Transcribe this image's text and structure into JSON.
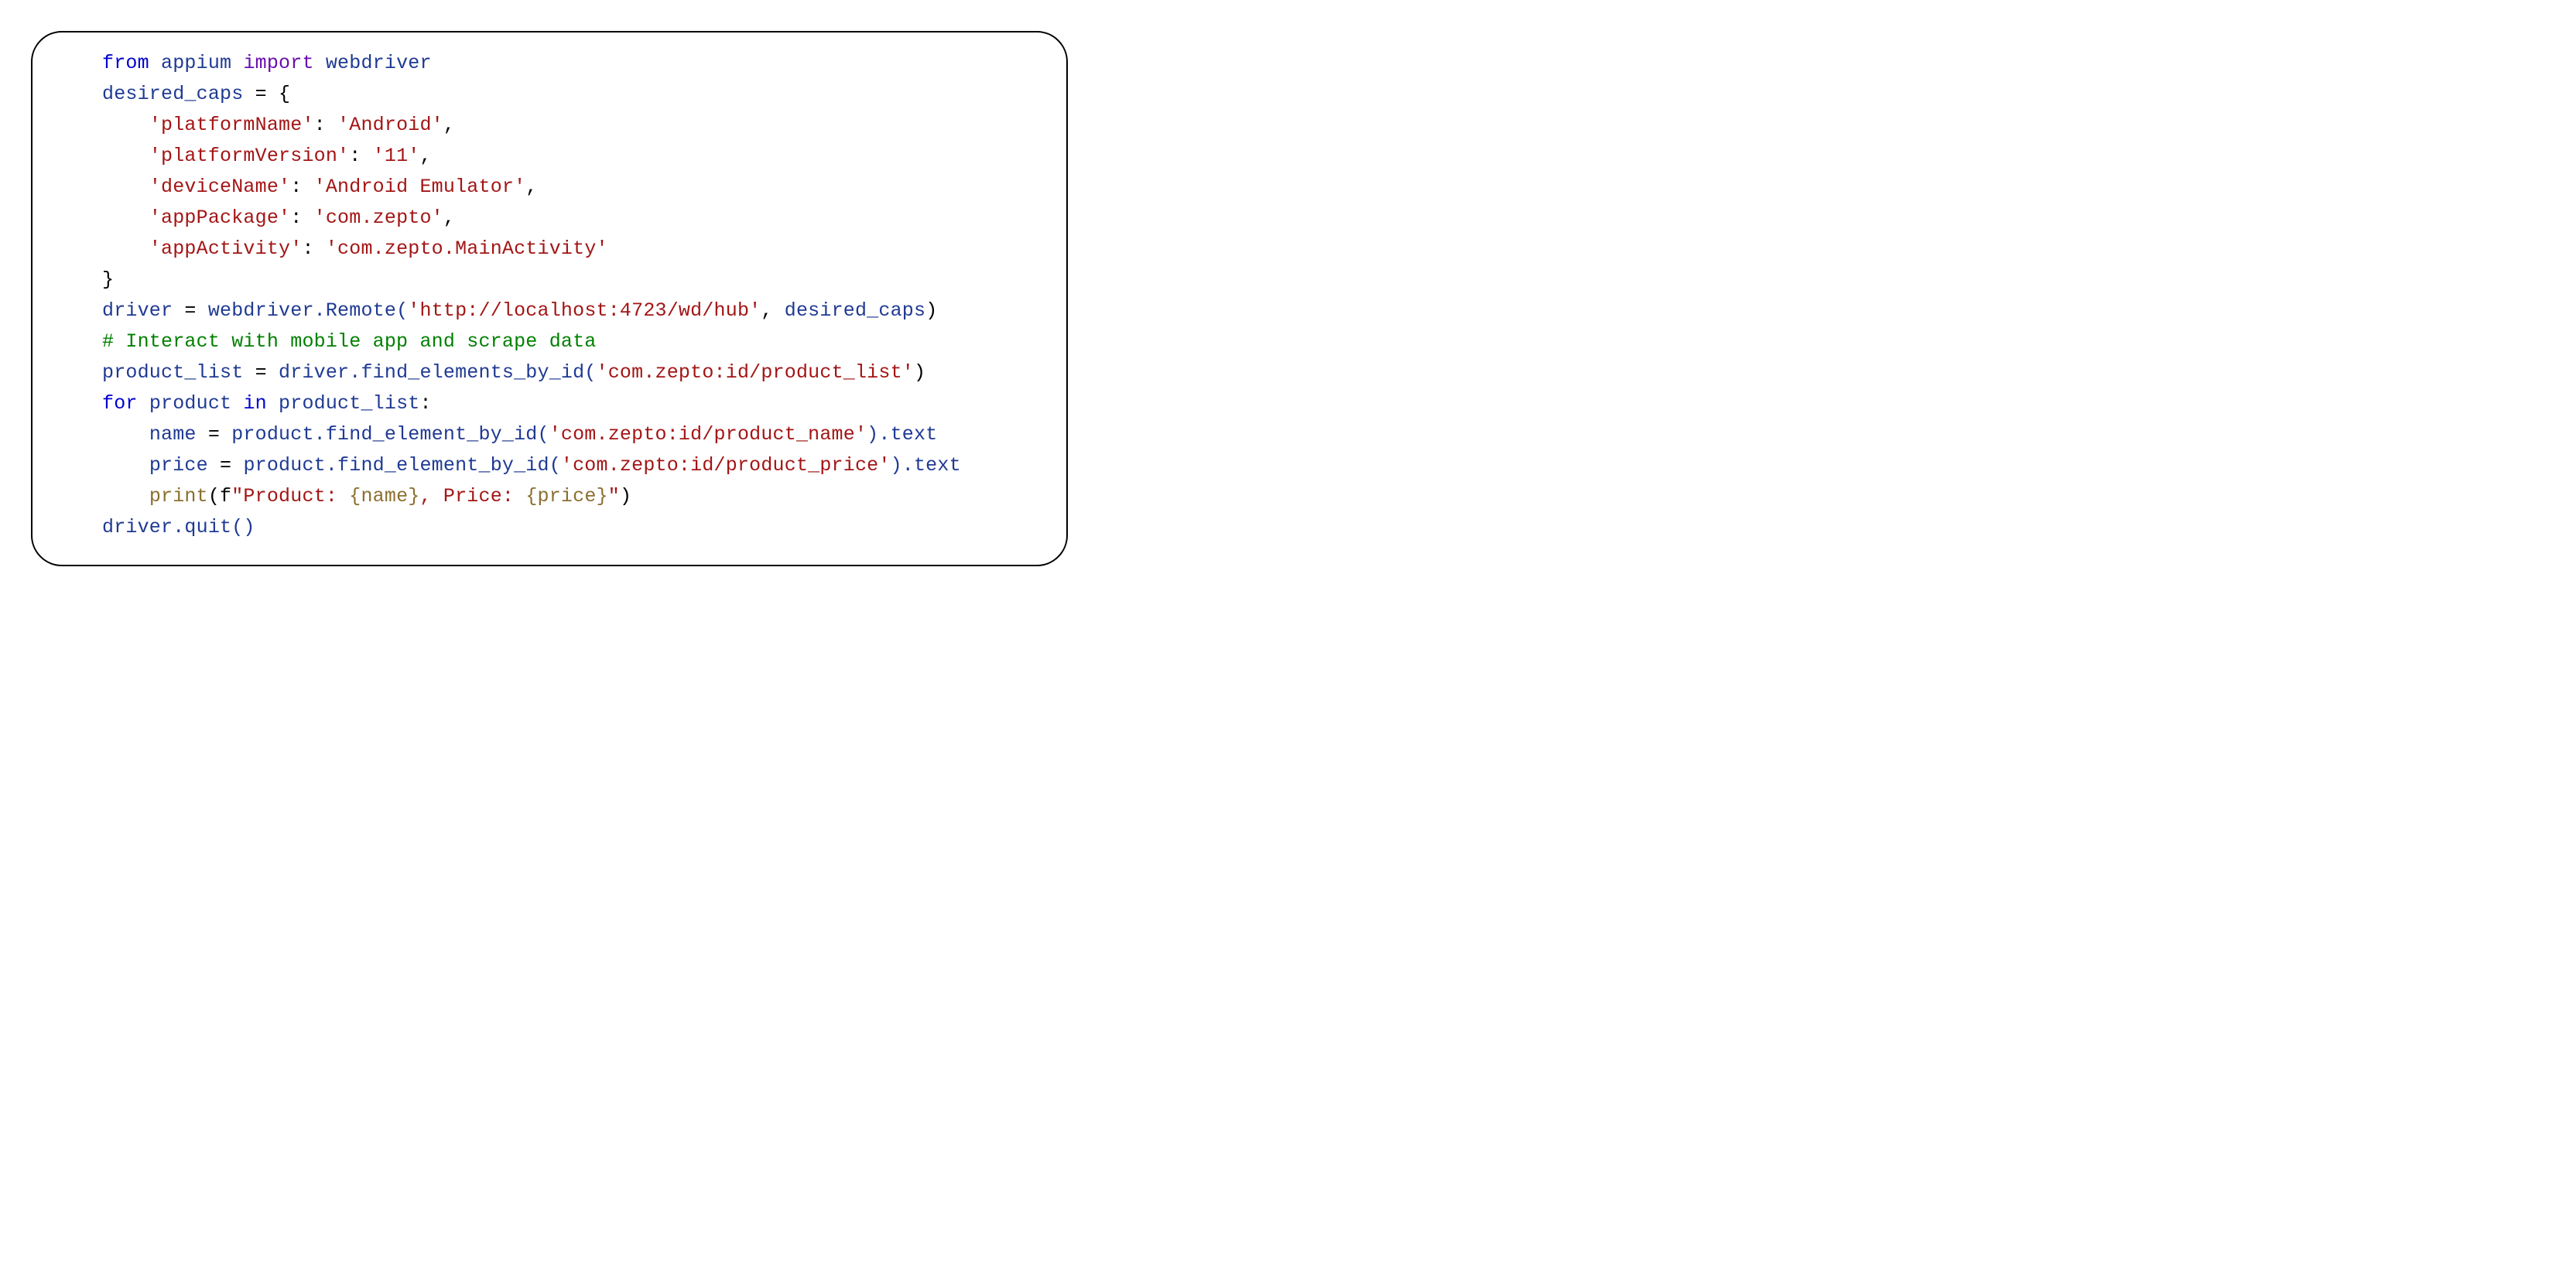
{
  "code": {
    "l1": {
      "kw_from": "from",
      "mod_appium": "appium",
      "kw_import": "import",
      "mod_webdriver": "webdriver"
    },
    "l2": {
      "var_desired_caps": "desired_caps",
      "eq": " = {"
    },
    "l3": {
      "indent": "    ",
      "key": "'platformName'",
      "colon": ": ",
      "val": "'Android'",
      "comma": ","
    },
    "l4": {
      "indent": "    ",
      "key": "'platformVersion'",
      "colon": ": ",
      "val": "'11'",
      "comma": ","
    },
    "l5": {
      "indent": "    ",
      "key": "'deviceName'",
      "colon": ": ",
      "val": "'Android Emulator'",
      "comma": ","
    },
    "l6": {
      "indent": "    ",
      "key": "'appPackage'",
      "colon": ": ",
      "val": "'com.zepto'",
      "comma": ","
    },
    "l7": {
      "indent": "    ",
      "key": "'appActivity'",
      "colon": ": ",
      "val": "'com.zepto.MainActivity'"
    },
    "l8": {
      "close": "}"
    },
    "l9": {
      "var_driver": "driver",
      "eq": " = ",
      "call1": "webdriver.Remote(",
      "url": "'http://localhost:4723/wd/hub'",
      "comma": ", ",
      "arg": "desired_caps",
      "close": ")"
    },
    "l10": {
      "comment": "# Interact with mobile app and scrape data"
    },
    "l11": {
      "var_pl": "product_list",
      "eq": " = ",
      "call": "driver.find_elements_by_id(",
      "arg": "'com.zepto:id/product_list'",
      "close": ")"
    },
    "l12": {
      "kw_for": "for",
      "sp1": " ",
      "var_product": "product",
      "sp2": " ",
      "kw_in": "in",
      "sp3": " ",
      "var_pl": "product_list",
      "colon": ":"
    },
    "l13": {
      "indent": "    ",
      "var_name": "name",
      "eq": " = ",
      "call": "product.find_element_by_id(",
      "arg": "'com.zepto:id/product_name'",
      "close": ").text"
    },
    "l14": {
      "indent": "    ",
      "var_price": "price",
      "eq": " = ",
      "call": "product.find_element_by_id(",
      "arg": "'com.zepto:id/product_price'",
      "close": ").text"
    },
    "l15": {
      "indent": "    ",
      "fn_print": "print",
      "open": "(f",
      "s1": "\"Product: ",
      "br1": "{name}",
      "s2": ", Price: ",
      "br2": "{price}",
      "s3": "\"",
      "close": ")"
    },
    "l16": {
      "call": "driver.quit()"
    }
  }
}
